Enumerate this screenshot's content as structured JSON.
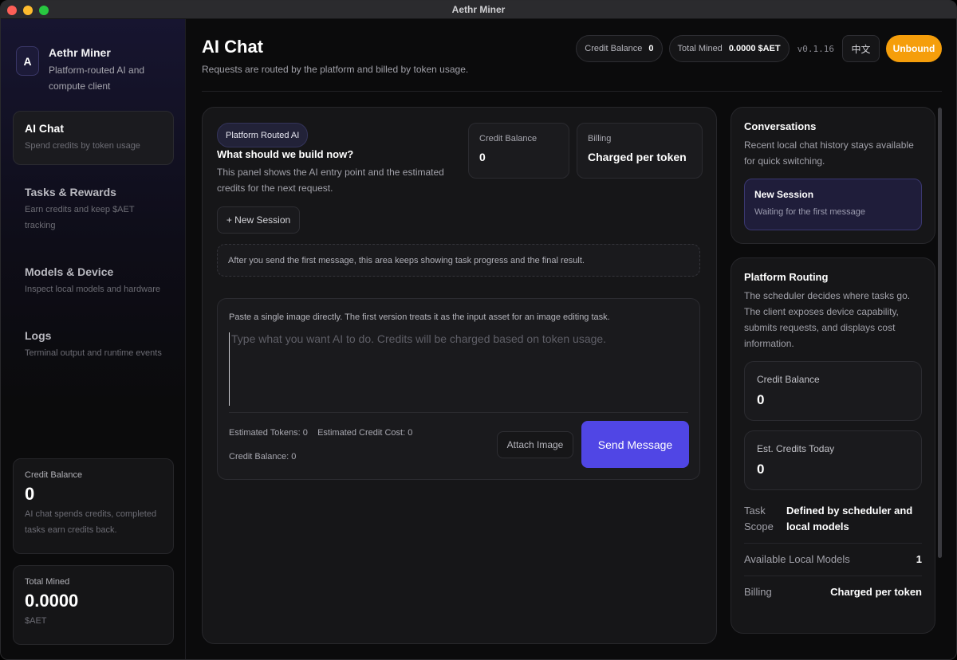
{
  "window": {
    "title": "Aethr Miner"
  },
  "brand": {
    "logo_letter": "A",
    "name": "Aethr Miner",
    "subtitle": "Platform-routed AI and compute client"
  },
  "sidebar": {
    "items": [
      {
        "title": "AI Chat",
        "desc": "Spend credits by token usage",
        "active": true
      },
      {
        "title": "Tasks & Rewards",
        "desc": "Earn credits and keep $AET tracking",
        "active": false
      },
      {
        "title": "Models & Device",
        "desc": "Inspect local models and hardware",
        "active": false
      },
      {
        "title": "Logs",
        "desc": "Terminal output and runtime events",
        "active": false
      }
    ],
    "credit_card": {
      "label": "Credit Balance",
      "value": "0",
      "note": "AI chat spends credits, completed tasks earn credits back."
    },
    "mined_card": {
      "label": "Total Mined",
      "value": "0.0000",
      "unit": "$AET"
    }
  },
  "header": {
    "title": "AI Chat",
    "subtitle": "Requests are routed by the platform and billed by token usage.",
    "credit_label": "Credit Balance",
    "credit_value": "0",
    "mined_label": "Total Mined",
    "mined_value": "0.0000 $AET",
    "version": "v0.1.16",
    "lang": "中文",
    "unbound": "Unbound"
  },
  "main": {
    "badge": "Platform Routed AI",
    "ask_title": "What should we build now?",
    "ask_sub": "This panel shows the AI entry point and the estimated credits for the next request.",
    "credit_card": {
      "label": "Credit Balance",
      "value": "0"
    },
    "billing_card": {
      "label": "Billing",
      "value": "Charged per token"
    },
    "new_session": "+ New Session",
    "progress_note": "After you send the first message, this area keeps showing task progress and the final result.",
    "composer": {
      "hint": "Paste a single image directly. The first version treats it as the input asset for an image editing task.",
      "placeholder": "Type what you want AI to do. Credits will be charged based on token usage.",
      "est_tokens": "Estimated Tokens: 0",
      "est_cost": "Estimated Credit Cost: 0",
      "balance": "Credit Balance: 0",
      "attach": "Attach Image",
      "send": "Send Message"
    }
  },
  "conversations": {
    "title": "Conversations",
    "subtitle": "Recent local chat history stays available for quick switching.",
    "session_title": "New Session",
    "session_sub": "Waiting for the first message"
  },
  "routing": {
    "title": "Platform Routing",
    "subtitle": "The scheduler decides where tasks go. The client exposes device capability, submits requests, and displays cost information.",
    "credit_label": "Credit Balance",
    "credit_value": "0",
    "est_label": "Est. Credits Today",
    "est_value": "0",
    "rows": [
      {
        "k": "Task Scope",
        "v": "Defined by scheduler and local models"
      },
      {
        "k": "Available Local Models",
        "v": "1"
      },
      {
        "k": "Billing",
        "v": "Charged per token"
      }
    ]
  }
}
